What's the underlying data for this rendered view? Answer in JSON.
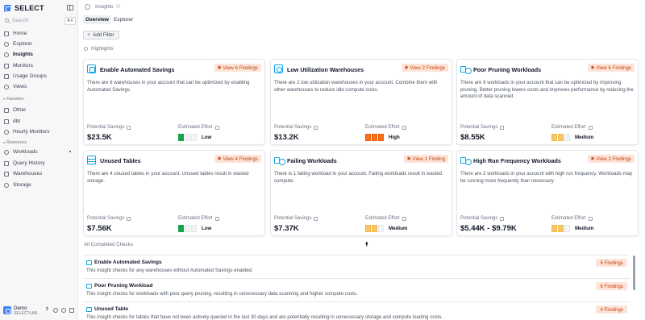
{
  "app": {
    "logo_text": "SELECT"
  },
  "sidebar": {
    "search_placeholder": "Search",
    "search_shortcut": "⌘K",
    "nav": [
      {
        "label": "Home",
        "icon": "home-icon"
      },
      {
        "label": "Explorer",
        "icon": "explorer-icon"
      },
      {
        "label": "Insights",
        "icon": "insights-icon",
        "active": true
      },
      {
        "label": "Monitors",
        "icon": "monitors-icon"
      },
      {
        "label": "Usage Groups",
        "icon": "usage-groups-icon"
      },
      {
        "label": "Views",
        "icon": "views-icon"
      }
    ],
    "favorites_label": "Favorites",
    "favorites": [
      {
        "label": "Other",
        "icon": "folder-icon"
      },
      {
        "label": "dbt",
        "icon": "folder-icon"
      },
      {
        "label": "Hourly Monitors",
        "icon": "monitor-icon"
      }
    ],
    "resources_label": "Resources",
    "resources": [
      {
        "label": "Workloads",
        "icon": "workloads-icon"
      },
      {
        "label": "Query History",
        "icon": "query-history-icon"
      },
      {
        "label": "Warehouses",
        "icon": "warehouses-icon"
      },
      {
        "label": "Storage",
        "icon": "storage-icon"
      }
    ],
    "user": {
      "name": "Demo",
      "account": "SELECTLAB..."
    }
  },
  "header": {
    "title": "Insights",
    "tabs": [
      "Overview",
      "Explorer"
    ],
    "active_tab": "Overview",
    "add_filter_label": "Add Filter",
    "highlights_label": "Highlights"
  },
  "labels": {
    "potential_savings": "Potential Savings",
    "estimated_effort": "Estimated Effort"
  },
  "cards": [
    {
      "title": "Enable Automated Savings",
      "findings": "View 6 Findings",
      "icon": "automated-savings-icon",
      "description": "There are 6 warehouses in your account that can be optimized by enabling Automated Savings.",
      "savings": "$23.5K",
      "effort": "Low"
    },
    {
      "title": "Low Utilization Warehouses",
      "findings": "View 2 Findings",
      "icon": "warehouse-icon",
      "description": "There are 2 low utilization warehouses in your account. Combine them with other warehouses to reduce idle compute costs.",
      "savings": "$13.2K",
      "effort": "High"
    },
    {
      "title": "Poor Pruning Workloads",
      "findings": "View 6 Findings",
      "icon": "workload-icon",
      "description": "There are 6 workloads in your account that can be optimized by improving pruning. Better pruning lowers costs and improves performance by reducing the amount of data scanned.",
      "savings": "$8.55K",
      "effort": "Medium"
    },
    {
      "title": "Unused Tables",
      "findings": "View 4 Findings",
      "icon": "table-icon",
      "description": "There are 4 unused tables in your account. Unused tables result in wasted storage.",
      "savings": "$7.56K",
      "effort": "Low"
    },
    {
      "title": "Failing Workloads",
      "findings": "View 1 Finding",
      "icon": "workload-icon",
      "description": "There is 1 failing workload in your account. Failing workloads result in wasted compute.",
      "savings": "$7.37K",
      "effort": "Medium"
    },
    {
      "title": "High Run Frequency Workloads",
      "findings": "View 2 Findings",
      "icon": "workload-icon",
      "description": "There are 2 workloads in your account with high run frequency. Workloads may be running more frequently than necessary.",
      "savings": "$5.44K - $9.79K",
      "effort": "Medium"
    }
  ],
  "completed": {
    "label": "All Completed Checks",
    "rows": [
      {
        "title": "Enable Automated Savings",
        "description": "This insight checks for any warehouses without Automated Savings enabled.",
        "badge": "6 Findings"
      },
      {
        "title": "Poor Pruning Workload",
        "description": "This insight checks for workloads with poor query pruning, resulting in unnecessary data scanning and higher compute costs.",
        "badge": "6 Findings"
      },
      {
        "title": "Unused Table",
        "description": "This insight checks for tables that have not been actively queried in the last 30 days and are potentially resulting in unnecessary storage and compute loading costs.",
        "badge": "4 Findings"
      }
    ]
  },
  "colors": {
    "brand": "#3b82f6",
    "badge_bg": "#fde4d8",
    "badge_text": "#c2410c",
    "effort_low": "#16a34a",
    "effort_medium": "#f5c76a",
    "effort_high": "#f97316"
  }
}
